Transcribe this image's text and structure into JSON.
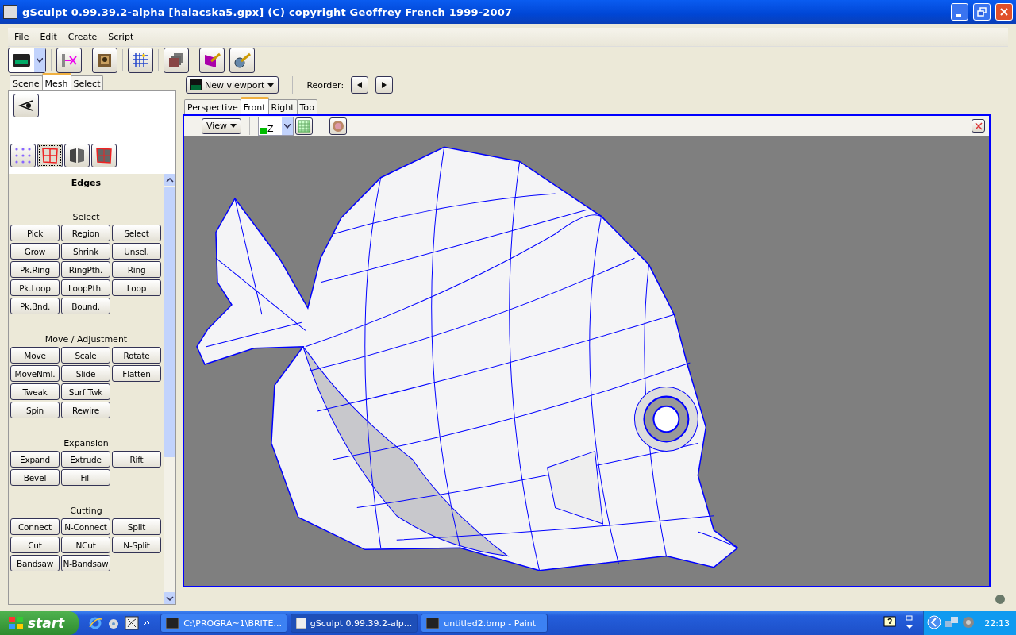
{
  "window": {
    "title": "gSculpt 0.99.39.2-alpha [halacska5.gpx]  (C) copyright Geoffrey French 1999-2007"
  },
  "menu": [
    "File",
    "Edit",
    "Create",
    "Script"
  ],
  "left_tabs": [
    {
      "label": "Scene",
      "selected": false
    },
    {
      "label": "Mesh",
      "selected": true
    },
    {
      "label": "Select",
      "selected": false
    }
  ],
  "mode_buttons": [
    {
      "kind": "vertices",
      "selected": false
    },
    {
      "kind": "edges",
      "selected": true
    },
    {
      "kind": "faces",
      "selected": false
    },
    {
      "kind": "body",
      "selected": false
    }
  ],
  "panel": {
    "title": "Edges",
    "sections": [
      {
        "title": "Select",
        "rows": [
          [
            "Pick",
            "Region",
            "Select"
          ],
          [
            "Grow",
            "Shrink",
            "Unsel."
          ],
          [
            "Pk.Ring",
            "RingPth.",
            "Ring"
          ],
          [
            "Pk.Loop",
            "LoopPth.",
            "Loop"
          ],
          [
            "Pk.Bnd.",
            "Bound."
          ]
        ]
      },
      {
        "title": "Move / Adjustment",
        "rows": [
          [
            "Move",
            "Scale",
            "Rotate"
          ],
          [
            "MoveNml.",
            "Slide",
            "Flatten"
          ],
          [
            "Tweak",
            "Surf Twk"
          ],
          [
            "Spin",
            "Rewire"
          ]
        ]
      },
      {
        "title": "Expansion",
        "rows": [
          [
            "Expand",
            "Extrude",
            "Rift"
          ],
          [
            "Bevel",
            "Fill"
          ]
        ]
      },
      {
        "title": "Cutting",
        "rows": [
          [
            "Connect",
            "N-Connect",
            "Split"
          ],
          [
            "Cut",
            "NCut",
            "N-Split"
          ],
          [
            "Bandsaw",
            "N-Bandsaw"
          ]
        ]
      }
    ]
  },
  "new_viewport": "New viewport",
  "reorder_label": "Reorder:",
  "view_tabs": [
    {
      "label": "Perspective",
      "selected": false
    },
    {
      "label": "Front",
      "selected": true
    },
    {
      "label": "Right",
      "selected": false
    },
    {
      "label": "Top",
      "selected": false
    }
  ],
  "viewport": {
    "view_button": "View",
    "axis": "Z"
  },
  "taskbar": {
    "start": "start",
    "tasks": [
      {
        "label": "C:\\PROGRA~1\\BRITE...",
        "selected": false
      },
      {
        "label": "gSculpt 0.99.39.2-alp...",
        "selected": true
      },
      {
        "label": "untitled2.bmp - Paint",
        "selected": false
      }
    ],
    "clock": "22:13"
  }
}
